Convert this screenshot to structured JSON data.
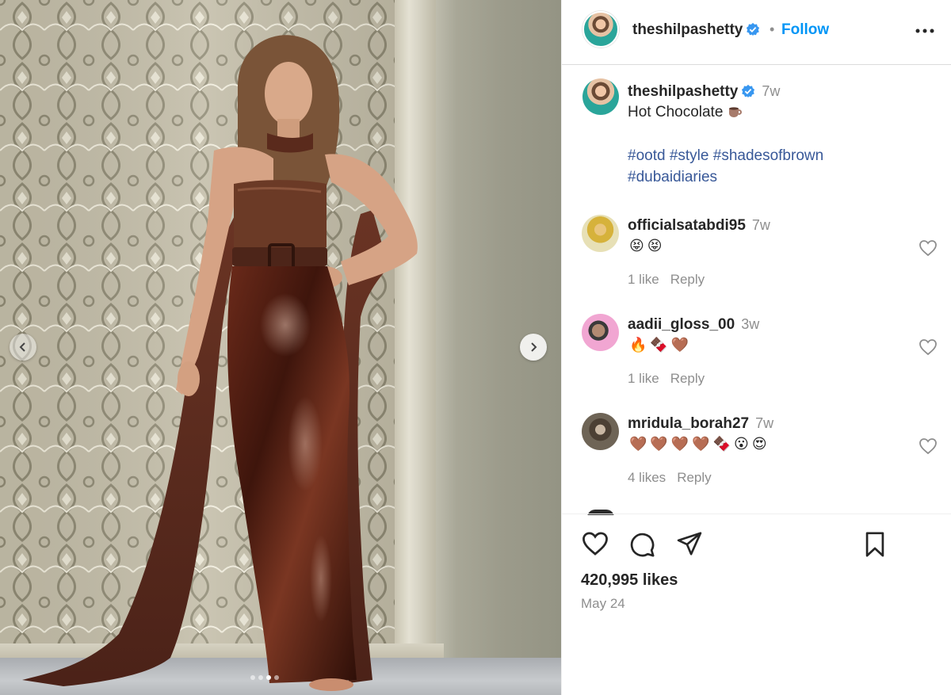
{
  "post": {
    "username": "theshilpashetty",
    "follow_label": "Follow",
    "separator": "•",
    "caption": {
      "username": "theshilpashetty",
      "time": "7w",
      "text": "Hot Chocolate",
      "emoji": "coffee-cup-icon",
      "hashtags": [
        "#ootd",
        "#style",
        "#shadesofbrown",
        "#dubaidiaries"
      ]
    },
    "comments": [
      {
        "username": "officialsatabdi95",
        "time": "7w",
        "emojis": "😝😝",
        "likes": "1 like",
        "reply": "Reply"
      },
      {
        "username": "aadii_gloss_00",
        "time": "3w",
        "emojis": "🔥🍫🤎",
        "likes": "1 like",
        "reply": "Reply"
      },
      {
        "username": "mridula_borah27",
        "time": "7w",
        "emojis": "🤎🤎🤎🤎🍫😮😍",
        "likes": "4 likes",
        "reply": "Reply"
      }
    ],
    "likes_count": "420,995 likes",
    "date": "May 24"
  },
  "media": {
    "carousel_dots": 4,
    "active_dot": 3
  },
  "colors": {
    "accent": "#0095f6",
    "hashtag": "#385898",
    "verified": "#3897f0",
    "muted": "#8e8e8e",
    "dress": "#4a1f12"
  }
}
